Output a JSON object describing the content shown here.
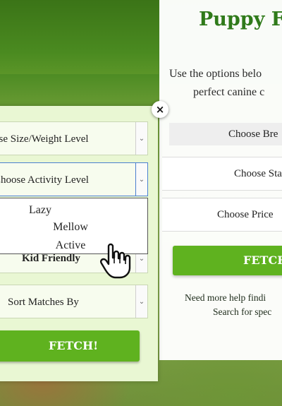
{
  "main": {
    "title": "Puppy F",
    "intro_line1": "Use the options belo",
    "intro_line2": "perfect canine c",
    "breed_label": "Choose Bre",
    "state_label": "Choose Sta",
    "price_label": "Choose Price",
    "fetch_label": "FETCH",
    "help_line1": "Need more help findi",
    "help_line2": "Search for spec"
  },
  "popup": {
    "close_icon": "×",
    "size_label": "ose Size/Weight Level",
    "activity_label": "Choose Activity Level",
    "activity_options": [
      "Lazy",
      "Mellow",
      "Active"
    ],
    "kid_label": "Kid Friendly",
    "sort_label": "Sort Matches By",
    "fetch_label": "FETCH!",
    "arrow_icon": "⌄"
  },
  "colors": {
    "brand_green": "#2f7a1a",
    "button_green": "#5fb21f",
    "popup_bg": "#e9f7d3"
  },
  "icons": [
    "close-icon",
    "chevron-down-icon",
    "hand-pointer-icon"
  ]
}
